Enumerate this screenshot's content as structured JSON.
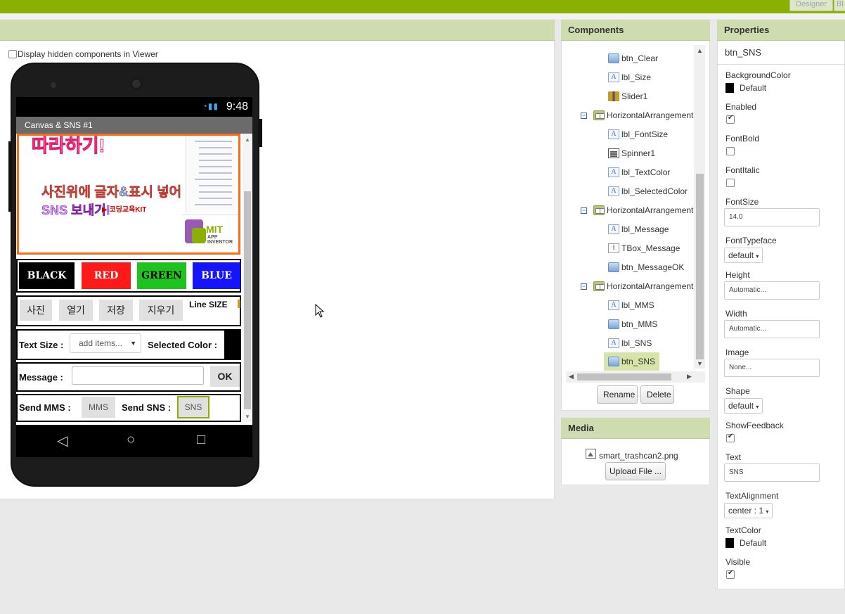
{
  "topbar": {
    "designer_label": "Designer",
    "blocks_label": "Bl"
  },
  "viewer": {
    "display_hidden_label": "Display hidden components in Viewer",
    "display_hidden_checked": false,
    "phone": {
      "time": "9:48",
      "screen_title": "Canvas & SNS #1",
      "canvas_text_big": "따라하기!",
      "canvas_text_line1": "사진위에 글자&표시 넣어",
      "canvas_text_line2": "SNS 보내기!",
      "canvas_youtube": "▶ 코딩교육KIT",
      "mit_logo_main": "MIT",
      "mit_logo_sub": "APP INVENTOR",
      "color_buttons": [
        {
          "label": "BLACK",
          "color": "#000000"
        },
        {
          "label": "RED",
          "color": "#ff1a1a"
        },
        {
          "label": "GREEN",
          "color": "#1ec31e"
        },
        {
          "label": "BLUE",
          "color": "#1414ff"
        }
      ],
      "action_buttons": [
        "사진",
        "열기",
        "저장",
        "지우기"
      ],
      "line_size_label": "Line SIZE",
      "text_size_label": "Text Size :",
      "spinner_placeholder": "add items...",
      "selected_color_label": "Selected Color :",
      "message_label": "Message :",
      "ok_label": "OK",
      "send_mms_label": "Send MMS :",
      "mms_button": "MMS",
      "send_sns_label": "Send SNS :",
      "sns_button": "SNS"
    }
  },
  "components": {
    "title": "Components",
    "items": [
      {
        "name": "btn_Clear",
        "type": "button",
        "level": 2
      },
      {
        "name": "lbl_Size",
        "type": "label",
        "level": 2
      },
      {
        "name": "Slider1",
        "type": "slider",
        "level": 2
      },
      {
        "name": "HorizontalArrangement",
        "type": "harr",
        "level": 1
      },
      {
        "name": "lbl_FontSize",
        "type": "label",
        "level": 2
      },
      {
        "name": "Spinner1",
        "type": "spinner",
        "level": 2
      },
      {
        "name": "lbl_TextColor",
        "type": "label",
        "level": 2
      },
      {
        "name": "lbl_SelectedColor",
        "type": "label",
        "level": 2
      },
      {
        "name": "HorizontalArrangement",
        "type": "harr",
        "level": 1
      },
      {
        "name": "lbl_Message",
        "type": "label",
        "level": 2
      },
      {
        "name": "TBox_Message",
        "type": "textbox",
        "level": 2
      },
      {
        "name": "btn_MessageOK",
        "type": "button",
        "level": 2
      },
      {
        "name": "HorizontalArrangement",
        "type": "harr",
        "level": 1
      },
      {
        "name": "lbl_MMS",
        "type": "label",
        "level": 2
      },
      {
        "name": "btn_MMS",
        "type": "button",
        "level": 2
      },
      {
        "name": "lbl_SNS",
        "type": "label",
        "level": 2
      },
      {
        "name": "btn_SNS",
        "type": "button",
        "level": 2,
        "selected": true
      }
    ],
    "rename_label": "Rename",
    "delete_label": "Delete"
  },
  "media": {
    "title": "Media",
    "file": "smart_trashcan2.png",
    "upload_label": "Upload File ..."
  },
  "properties": {
    "title": "Properties",
    "component": "btn_SNS",
    "background_color_label": "BackgroundColor",
    "background_color_value": "Default",
    "enabled_label": "Enabled",
    "enabled": true,
    "fontbold_label": "FontBold",
    "fontbold": false,
    "fontitalic_label": "FontItalic",
    "fontitalic": false,
    "fontsize_label": "FontSize",
    "fontsize_value": "14.0",
    "fonttypeface_label": "FontTypeface",
    "fonttypeface_value": "default",
    "height_label": "Height",
    "height_value": "Automatic...",
    "width_label": "Width",
    "width_value": "Automatic...",
    "image_label": "Image",
    "image_value": "None...",
    "shape_label": "Shape",
    "shape_value": "default",
    "showfeedback_label": "ShowFeedback",
    "showfeedback": true,
    "text_label": "Text",
    "text_value": "SNS",
    "textalignment_label": "TextAlignment",
    "textalignment_value": "center : 1",
    "textcolor_label": "TextColor",
    "textcolor_value": "Default",
    "visible_label": "Visible",
    "visible": true
  }
}
